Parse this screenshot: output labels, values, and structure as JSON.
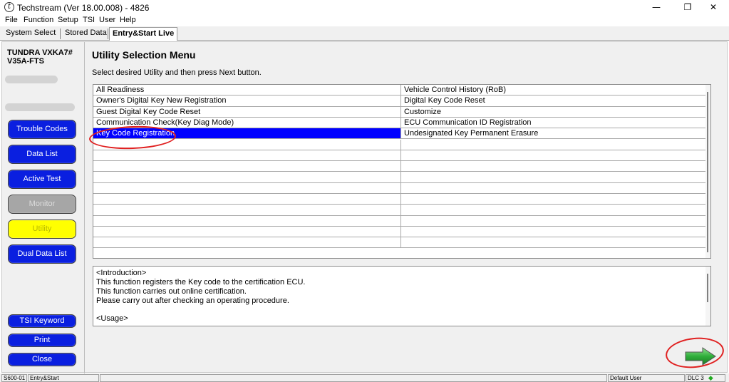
{
  "window": {
    "title": "Techstream (Ver 18.00.008) - 4826",
    "app_icon_glyph": "t",
    "controls": {
      "minimize": "—",
      "maximize": "❐",
      "close": "✕"
    }
  },
  "menu": [
    "File",
    "Function",
    "Setup",
    "TSI",
    "User",
    "Help"
  ],
  "tabs": [
    {
      "label": "System Select",
      "active": false
    },
    {
      "label": "Stored Data",
      "active": false
    },
    {
      "label": "Entry&Start Live",
      "active": true
    }
  ],
  "sidebar": {
    "vehicle_line1": "TUNDRA VXKA7#",
    "vehicle_line2": "V35A-FTS",
    "buttons": [
      {
        "label": "Trouble Codes",
        "state": "blue"
      },
      {
        "label": "Data List",
        "state": "blue"
      },
      {
        "label": "Active Test",
        "state": "blue"
      },
      {
        "label": "Monitor",
        "state": "disabled"
      },
      {
        "label": "Utility",
        "state": "selected"
      },
      {
        "label": "Dual Data List",
        "state": "blue"
      }
    ],
    "bottom_buttons": [
      {
        "label": "TSI Keyword"
      },
      {
        "label": "Print"
      },
      {
        "label": "Close"
      }
    ]
  },
  "main": {
    "title": "Utility Selection Menu",
    "instruction": "Select desired Utility and then press Next button.",
    "utilities": [
      [
        "All Readiness",
        "Vehicle Control History (RoB)"
      ],
      [
        "Owner's Digital Key New Registration",
        "Digital Key Code Reset"
      ],
      [
        "Guest Digital Key Code Reset",
        "Customize"
      ],
      [
        "Communication Check(Key Diag Mode)",
        "ECU Communication ID Registration"
      ],
      [
        "Key Code Registration",
        "Undesignated Key Permanent Erasure"
      ],
      [
        "",
        ""
      ],
      [
        "",
        ""
      ],
      [
        "",
        ""
      ],
      [
        "",
        ""
      ],
      [
        "",
        ""
      ],
      [
        "",
        ""
      ],
      [
        "",
        ""
      ],
      [
        "",
        ""
      ],
      [
        "",
        ""
      ],
      [
        "",
        ""
      ]
    ],
    "selected_utility": "Key Code Registration",
    "introduction": [
      "<Introduction>",
      "This function registers the Key code to the certification ECU.",
      "This function carries out online certification.",
      "Please carry out after checking an operating procedure.",
      "",
      "<Usage>"
    ],
    "next_button": "next-arrow-icon"
  },
  "statusbar": {
    "code": "S600-01",
    "mode": "Entry&Start",
    "user": "Default User",
    "connection": "DLC 3"
  },
  "colors": {
    "button_blue": "#0a1fe0",
    "selection_blue": "#0000ff",
    "utility_yellow": "#ffff00",
    "annotation_red": "#e02020",
    "arrow_green": "#2fae3a",
    "status_green": "#22aa22"
  }
}
